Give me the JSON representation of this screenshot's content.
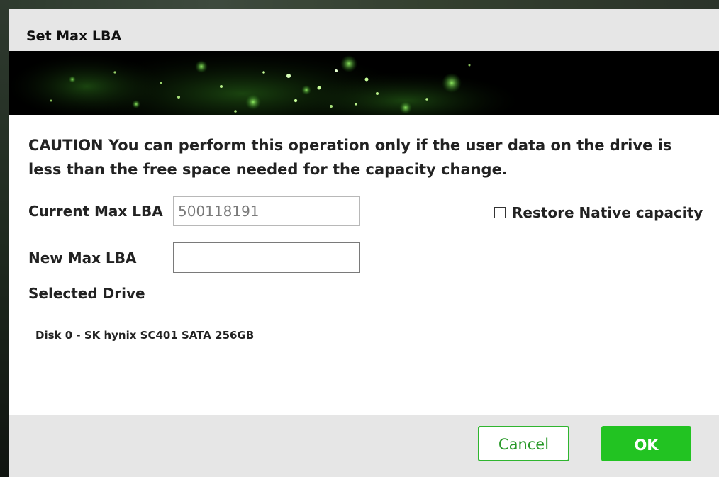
{
  "dialog": {
    "title": "Set Max LBA"
  },
  "caution": {
    "text": "CAUTION You can perform this operation only if the user data on the drive is less than the free space needed for the capacity change."
  },
  "form": {
    "current_max_lba_label": "Current Max LBA",
    "current_max_lba_value": "500118191",
    "new_max_lba_label": "New Max LBA",
    "new_max_lba_value": "",
    "restore_native_label": "Restore Native capacity",
    "restore_native_checked": false,
    "selected_drive_label": "Selected Drive",
    "selected_drive_value": "Disk 0 - SK hynix SC401 SATA 256GB"
  },
  "footer": {
    "cancel_label": "Cancel",
    "ok_label": "OK"
  },
  "colors": {
    "accent_green": "#22c322",
    "titlebar_gray": "#e6e6e6"
  }
}
